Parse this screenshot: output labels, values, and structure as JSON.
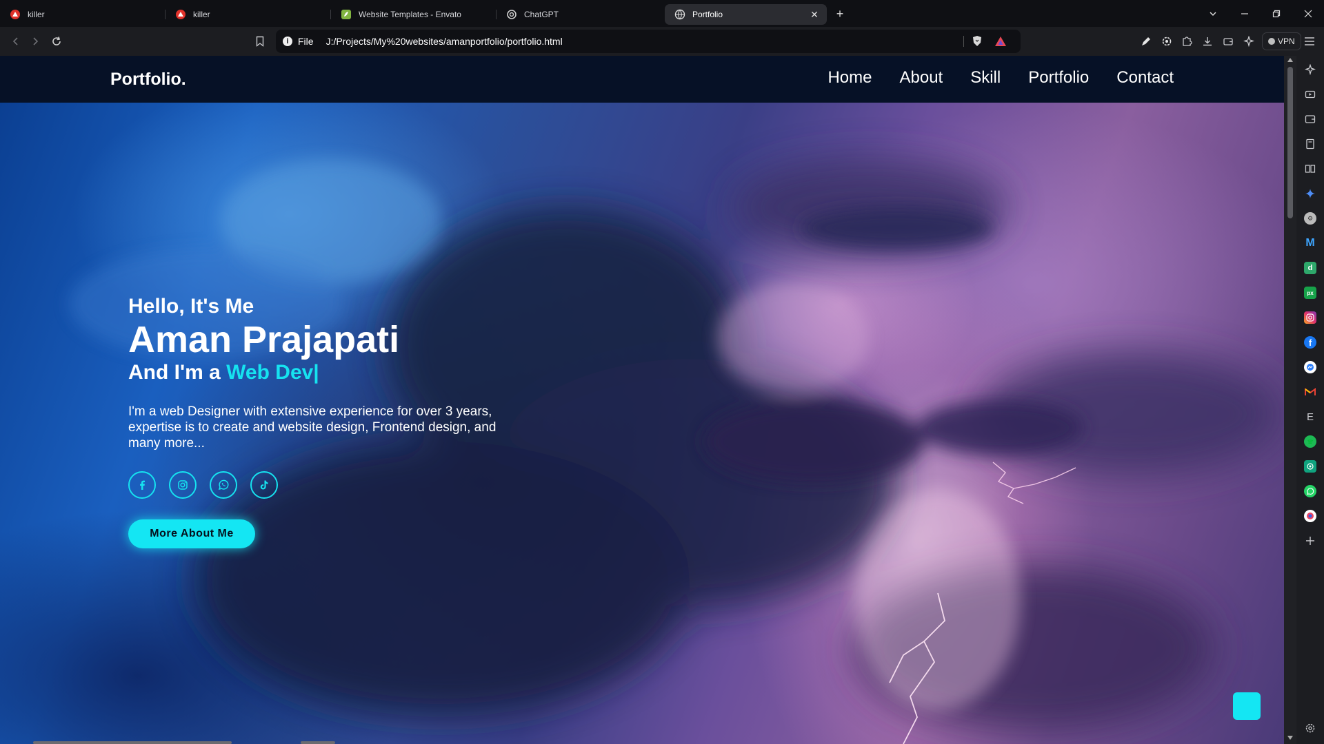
{
  "browser": {
    "tabs": [
      {
        "title": "killer",
        "favicon": "brave-shield-icon",
        "active": false
      },
      {
        "title": "killer",
        "favicon": "brave-shield-icon",
        "active": false
      },
      {
        "title": "Website Templates - Envato",
        "favicon": "envato-icon",
        "active": false
      },
      {
        "title": "ChatGPT",
        "favicon": "chatgpt-icon",
        "active": false
      },
      {
        "title": "Portfolio",
        "favicon": "globe-icon",
        "active": true
      }
    ],
    "new_tab": "+",
    "url_scheme": "File",
    "url": "J:/Projects/My%20websites/amanportfolio/portfolio.html",
    "vpn_label": "VPN",
    "accent": "#16e3f0"
  },
  "page": {
    "logo": "Portfolio.",
    "nav": [
      "Home",
      "About",
      "Skill",
      "Portfolio",
      "Contact"
    ],
    "greeting": "Hello, It's Me",
    "name": "Aman Prajapati",
    "role_prefix": "And I'm a ",
    "role_highlight": "Web Dev|",
    "description": "I'm a web Designer with extensive experience for over 3 years, expertise is to create and website design, Frontend design, and many more...",
    "socials": [
      "facebook-icon",
      "instagram-icon",
      "whatsapp-icon",
      "tiktok-icon"
    ],
    "cta": "More About Me"
  }
}
